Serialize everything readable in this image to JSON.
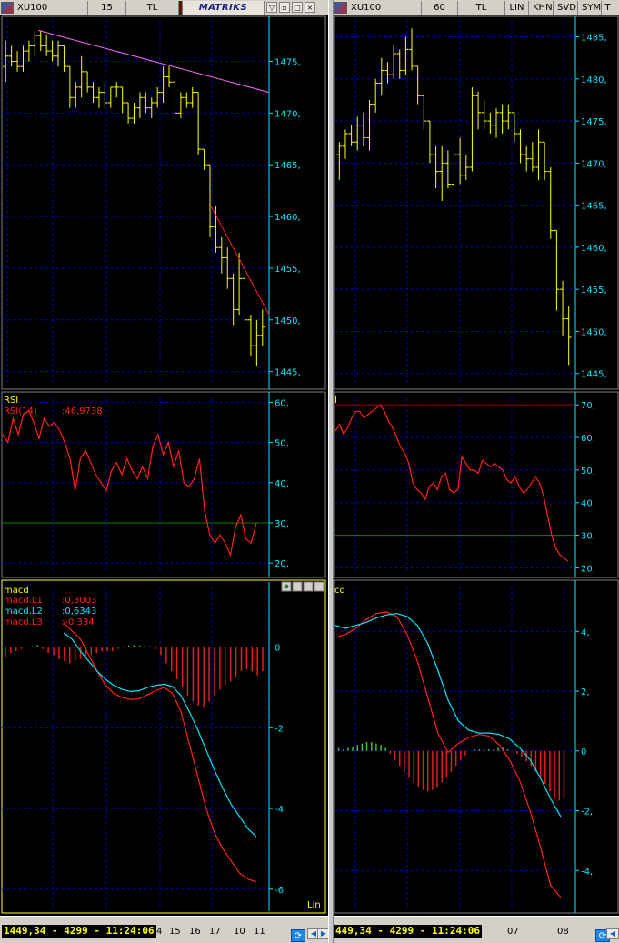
{
  "colors": {
    "price": "#ffff00",
    "rsi": "#ff2020",
    "macd_l1": "#ff2020",
    "macd_l2": "#00e5ff",
    "hist_pos": "#40c040",
    "hist_neg": "#e02020",
    "axis_text": "#00e5ff",
    "grid": "#0000c0",
    "trend_magenta": "#ff66ff",
    "trend_red": "#ff2020",
    "rsi_ref": "#008000"
  },
  "left": {
    "toolbar": {
      "symbol": "XU100",
      "period": "15",
      "currency": "TL",
      "brand": "MATRIKS"
    },
    "price_axis_ticks": [
      "1475,",
      "1470,",
      "1465,",
      "1460,",
      "1455,",
      "1450,",
      "1445,"
    ],
    "rsi": {
      "title": "RSI",
      "legend_label": "RSI(14)",
      "legend_value": ":46,9738",
      "ticks": [
        "60,",
        "50,",
        "40,",
        "30,",
        "20,"
      ]
    },
    "macd": {
      "title": "macd",
      "legend": [
        {
          "label": "macd.L1",
          "value": ":0,3003"
        },
        {
          "label": "macd.L2",
          "value": ":0,6343"
        },
        {
          "label": "macd.L3",
          "value": ":-0,334"
        }
      ],
      "ticks": [
        "0",
        "-2,",
        "-4,",
        "-6,"
      ],
      "scale_label": "Lin"
    },
    "status": {
      "quote": "1449,34 - 4299 - 11:24:06",
      "dates": [
        "4",
        "15",
        "16",
        "17",
        "10",
        "11"
      ]
    }
  },
  "right": {
    "toolbar": {
      "symbol": "XU100",
      "period": "60",
      "currency": "TL",
      "buttons": [
        "LIN",
        "KHN",
        "SVD",
        "SYM",
        "T"
      ]
    },
    "price_axis_ticks": [
      "1485,",
      "1480,",
      "1475,",
      "1470,",
      "1465,",
      "1460,",
      "1455,",
      "1450,",
      "1445,"
    ],
    "rsi": {
      "title": "I",
      "ticks": [
        "70,",
        "60,",
        "50,",
        "40,",
        "30,",
        "20,"
      ]
    },
    "macd": {
      "title": "cd",
      "ticks": [
        "4,",
        "2,",
        "0",
        "-2,",
        "-4,"
      ]
    },
    "status": {
      "quote": "449,34 - 4299 - 11:24:06",
      "dates": [
        "07",
        "08"
      ]
    }
  },
  "chart_data": [
    {
      "type": "ohlc",
      "panel": "left-price",
      "ylim": [
        1444,
        1479
      ],
      "bars": [
        [
          1474.5,
          1477,
          1473,
          1475.5
        ],
        [
          1475.5,
          1476.5,
          1474.5,
          1475
        ],
        [
          1475,
          1476,
          1474,
          1474.5
        ],
        [
          1474.5,
          1476.5,
          1474,
          1476
        ],
        [
          1476,
          1477,
          1475,
          1476.5
        ],
        [
          1476.5,
          1478,
          1475.5,
          1477.5
        ],
        [
          1477.5,
          1478,
          1476,
          1476.5
        ],
        [
          1476.5,
          1477.5,
          1475.5,
          1476
        ],
        [
          1476,
          1477,
          1475,
          1475.5
        ],
        [
          1475.5,
          1477,
          1474.5,
          1476.5
        ],
        [
          1476.5,
          1476.5,
          1474,
          1474.5
        ],
        [
          1474.5,
          1474.5,
          1470.5,
          1471.5
        ],
        [
          1471.5,
          1473,
          1470.5,
          1472.5
        ],
        [
          1472.5,
          1475.5,
          1471.5,
          1474
        ],
        [
          1474,
          1474,
          1472,
          1472.5
        ],
        [
          1472.5,
          1473,
          1471,
          1471.5
        ],
        [
          1471.5,
          1472.5,
          1470.5,
          1472
        ],
        [
          1472,
          1473,
          1470.5,
          1471
        ],
        [
          1471,
          1472.5,
          1470.5,
          1472.5
        ],
        [
          1472.5,
          1473,
          1471.5,
          1472.5
        ],
        [
          1472.5,
          1472.5,
          1470,
          1471
        ],
        [
          1471,
          1471,
          1469,
          1469.5
        ],
        [
          1469.5,
          1471,
          1469,
          1470.5
        ],
        [
          1470.5,
          1472,
          1469.5,
          1471.5
        ],
        [
          1471.5,
          1472,
          1470,
          1470.5
        ],
        [
          1470.5,
          1471.5,
          1469.5,
          1471
        ],
        [
          1471,
          1472.5,
          1470.5,
          1472
        ],
        [
          1472,
          1474.5,
          1471,
          1473.5
        ],
        [
          1473.5,
          1474.5,
          1472.5,
          1473
        ],
        [
          1473,
          1473,
          1469.5,
          1470
        ],
        [
          1470,
          1472,
          1469.5,
          1471.5
        ],
        [
          1471.5,
          1472,
          1470.5,
          1471
        ],
        [
          1471,
          1472.5,
          1470.5,
          1472
        ],
        [
          1472,
          1472,
          1466,
          1466.5
        ],
        [
          1466.5,
          1466.5,
          1464.5,
          1465
        ],
        [
          1465,
          1465,
          1458,
          1459
        ],
        [
          1459,
          1461,
          1456.5,
          1457
        ],
        [
          1457,
          1458,
          1454.5,
          1456
        ],
        [
          1456,
          1457,
          1453,
          1454
        ],
        [
          1454,
          1454.5,
          1449.5,
          1451
        ],
        [
          1451,
          1456.5,
          1450.5,
          1454
        ],
        [
          1454,
          1455,
          1449,
          1450
        ],
        [
          1450,
          1450.5,
          1446.5,
          1447.5
        ],
        [
          1447.5,
          1450,
          1445.5,
          1448.5
        ],
        [
          1448.5,
          1451,
          1447.5,
          1449.3
        ]
      ]
    },
    {
      "type": "line",
      "panel": "left-rsi",
      "ylim": [
        18,
        61
      ],
      "ref_level": 30,
      "values": [
        52,
        50,
        56,
        52,
        57,
        58,
        55,
        51,
        56,
        54,
        55,
        53,
        50,
        46,
        38,
        46,
        48,
        45,
        42,
        40,
        38,
        43,
        45,
        42,
        46,
        43,
        41,
        44,
        41,
        49,
        52,
        47,
        50,
        44,
        48,
        40,
        39,
        41,
        46,
        33,
        27,
        25,
        27,
        25,
        22,
        29,
        32,
        26,
        25,
        30
      ]
    },
    {
      "type": "line",
      "panel": "left-macd",
      "ylim": [
        -6.5,
        1.5
      ],
      "series": [
        {
          "values": [
            0.6,
            0.4,
            0.2,
            -0.2,
            -0.6,
            -0.95,
            -1.15,
            -1.25,
            -1.3,
            -1.28,
            -1.18,
            -1.08,
            -1.0,
            -1.15,
            -1.6,
            -2.4,
            -3.2,
            -4.0,
            -4.6,
            -5.0,
            -5.3,
            -5.6,
            -5.75,
            -5.82
          ]
        },
        {
          "values": [
            0.35,
            0.2,
            -0.1,
            -0.35,
            -0.6,
            -0.8,
            -0.95,
            -1.05,
            -1.1,
            -1.08,
            -1.0,
            -0.95,
            -0.92,
            -0.98,
            -1.2,
            -1.6,
            -2.05,
            -2.55,
            -3.05,
            -3.5,
            -3.9,
            -4.2,
            -4.5,
            -4.7
          ]
        }
      ],
      "histogram": [
        -0.25,
        -0.15,
        -0.1,
        -0.05,
        0,
        0.02,
        0.05,
        -0.05,
        -0.15,
        -0.2,
        -0.3,
        -0.35,
        -0.4,
        -0.35,
        -0.3,
        -0.25,
        -0.2,
        -0.15,
        -0.1,
        -0.1,
        -0.1,
        -0.05,
        0.02,
        0.04,
        0.05,
        0.04,
        0.03,
        0.02,
        -0.05,
        -0.2,
        -0.4,
        -0.6,
        -0.8,
        -1.0,
        -1.2,
        -1.35,
        -1.45,
        -1.5,
        -1.35,
        -1.2,
        -1.05,
        -0.95,
        -0.85,
        -0.75,
        -0.6,
        -0.55,
        -0.6,
        -0.7,
        -0.6
      ]
    },
    {
      "type": "ohlc",
      "panel": "right-price",
      "ylim": [
        1444,
        1487
      ],
      "bars": [
        [
          1471,
          1472.5,
          1468,
          1472
        ],
        [
          1472,
          1474,
          1470.5,
          1473.5
        ],
        [
          1473.5,
          1474.5,
          1472,
          1472.5
        ],
        [
          1472.5,
          1475.5,
          1471.5,
          1474.5
        ],
        [
          1474.5,
          1476,
          1472,
          1473
        ],
        [
          1473,
          1477.5,
          1471.5,
          1477
        ],
        [
          1477,
          1480,
          1476,
          1479.5
        ],
        [
          1479.5,
          1482.5,
          1478,
          1481
        ],
        [
          1481,
          1482,
          1479.5,
          1480.5
        ],
        [
          1480.5,
          1484,
          1480,
          1483
        ],
        [
          1483,
          1483.5,
          1480,
          1481
        ],
        [
          1481,
          1485,
          1480.5,
          1483.5
        ],
        [
          1483.5,
          1486,
          1481,
          1481.5
        ],
        [
          1481.5,
          1481.5,
          1477,
          1478
        ],
        [
          1478,
          1478,
          1474,
          1475
        ],
        [
          1475,
          1475,
          1470,
          1471
        ],
        [
          1471,
          1472,
          1467,
          1469
        ],
        [
          1469,
          1472,
          1465.5,
          1470
        ],
        [
          1470,
          1471.5,
          1467,
          1467.5
        ],
        [
          1467.5,
          1472,
          1466.5,
          1471
        ],
        [
          1471,
          1473,
          1467.5,
          1468.5
        ],
        [
          1468.5,
          1471,
          1468,
          1469.5
        ],
        [
          1469.5,
          1479,
          1469,
          1478
        ],
        [
          1478,
          1478.5,
          1474,
          1476
        ],
        [
          1476,
          1477.5,
          1474,
          1475
        ],
        [
          1475,
          1476,
          1473.5,
          1474.5
        ],
        [
          1474.5,
          1476.5,
          1473,
          1476
        ],
        [
          1476,
          1477,
          1473.5,
          1475
        ],
        [
          1475,
          1477,
          1474,
          1476
        ],
        [
          1476,
          1476,
          1472.5,
          1473.5
        ],
        [
          1473.5,
          1474,
          1470,
          1471
        ],
        [
          1471,
          1472,
          1469,
          1470.5
        ],
        [
          1470.5,
          1472.5,
          1469,
          1469.5
        ],
        [
          1469.5,
          1474,
          1468,
          1472.5
        ],
        [
          1472.5,
          1472.5,
          1468,
          1469
        ],
        [
          1469,
          1469.5,
          1461,
          1462
        ],
        [
          1462,
          1462,
          1452.5,
          1455
        ],
        [
          1455,
          1456,
          1449.5,
          1451.5
        ],
        [
          1451.5,
          1453,
          1446,
          1449.3
        ]
      ]
    },
    {
      "type": "line",
      "panel": "right-rsi",
      "ylim": [
        19,
        72
      ],
      "ref_level": 30,
      "values": [
        62,
        64,
        61,
        63,
        66,
        68,
        68,
        66,
        67,
        68,
        69,
        70,
        68,
        65,
        63,
        60,
        57,
        55,
        52,
        46,
        44,
        43,
        41,
        45,
        46,
        44,
        48,
        49,
        44,
        43,
        44,
        54,
        52,
        50,
        50,
        49,
        53,
        52,
        51,
        52,
        51,
        50,
        47,
        46,
        48,
        45,
        43,
        44,
        46,
        48,
        46,
        42,
        36,
        30,
        26,
        24,
        23,
        22
      ]
    },
    {
      "type": "line",
      "panel": "right-macd",
      "ylim": [
        -5.3,
        5.5
      ],
      "series": [
        {
          "values": [
            3.8,
            3.9,
            4.1,
            4.4,
            4.6,
            4.65,
            4.5,
            3.9,
            3.0,
            1.8,
            0.6,
            -0.05,
            0.25,
            0.45,
            0.55,
            0.5,
            0.2,
            -0.3,
            -1.0,
            -2.0,
            -3.2,
            -4.5,
            -4.9
          ]
        },
        {
          "values": [
            4.2,
            4.1,
            4.2,
            4.3,
            4.45,
            4.55,
            4.6,
            4.5,
            4.2,
            3.6,
            2.7,
            1.7,
            1.0,
            0.7,
            0.6,
            0.6,
            0.55,
            0.4,
            0.1,
            -0.3,
            -0.9,
            -1.6,
            -2.2
          ]
        }
      ],
      "histogram": [
        0.1,
        0.05,
        0.1,
        0.15,
        0.2,
        0.25,
        0.3,
        0.3,
        0.25,
        0.2,
        0.1,
        -0.1,
        -0.3,
        -0.5,
        -0.7,
        -0.9,
        -1.05,
        -1.2,
        -1.3,
        -1.35,
        -1.3,
        -1.2,
        -1.05,
        -0.9,
        -0.7,
        -0.5,
        -0.3,
        -0.15,
        0,
        0.05,
        0.05,
        0.05,
        0.05,
        0.05,
        0.1,
        0.1,
        0.05,
        0,
        -0.1,
        -0.2,
        -0.35,
        -0.5,
        -0.7,
        -0.9,
        -1.1,
        -1.35,
        -1.55,
        -1.65,
        -1.6
      ]
    }
  ]
}
